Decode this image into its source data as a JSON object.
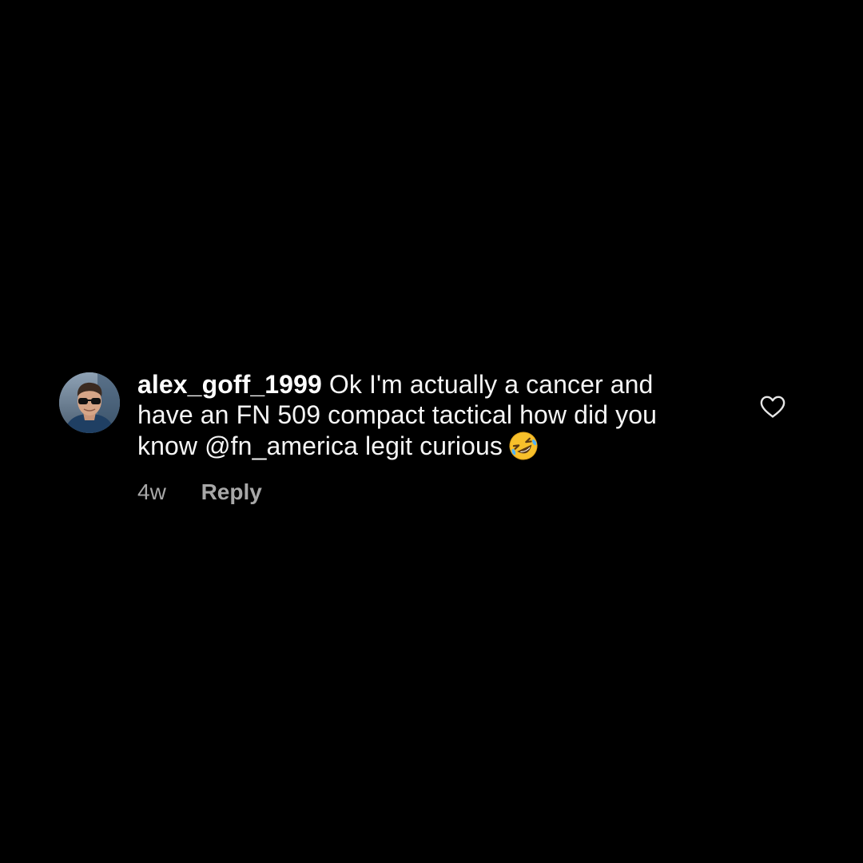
{
  "comment": {
    "username": "alex_goff_1999",
    "text": "Ok I'm actually a cancer and have an FN 509 compact tactical how did you know @fn_america legit curious",
    "emoji": "rolling-on-the-floor-laughing-emoji",
    "timestamp": "4w",
    "reply_label": "Reply",
    "like_icon": "heart-outline-icon"
  },
  "colors": {
    "background": "#000000",
    "text": "#f5f5f5",
    "secondary_text": "#a8a8a8"
  }
}
